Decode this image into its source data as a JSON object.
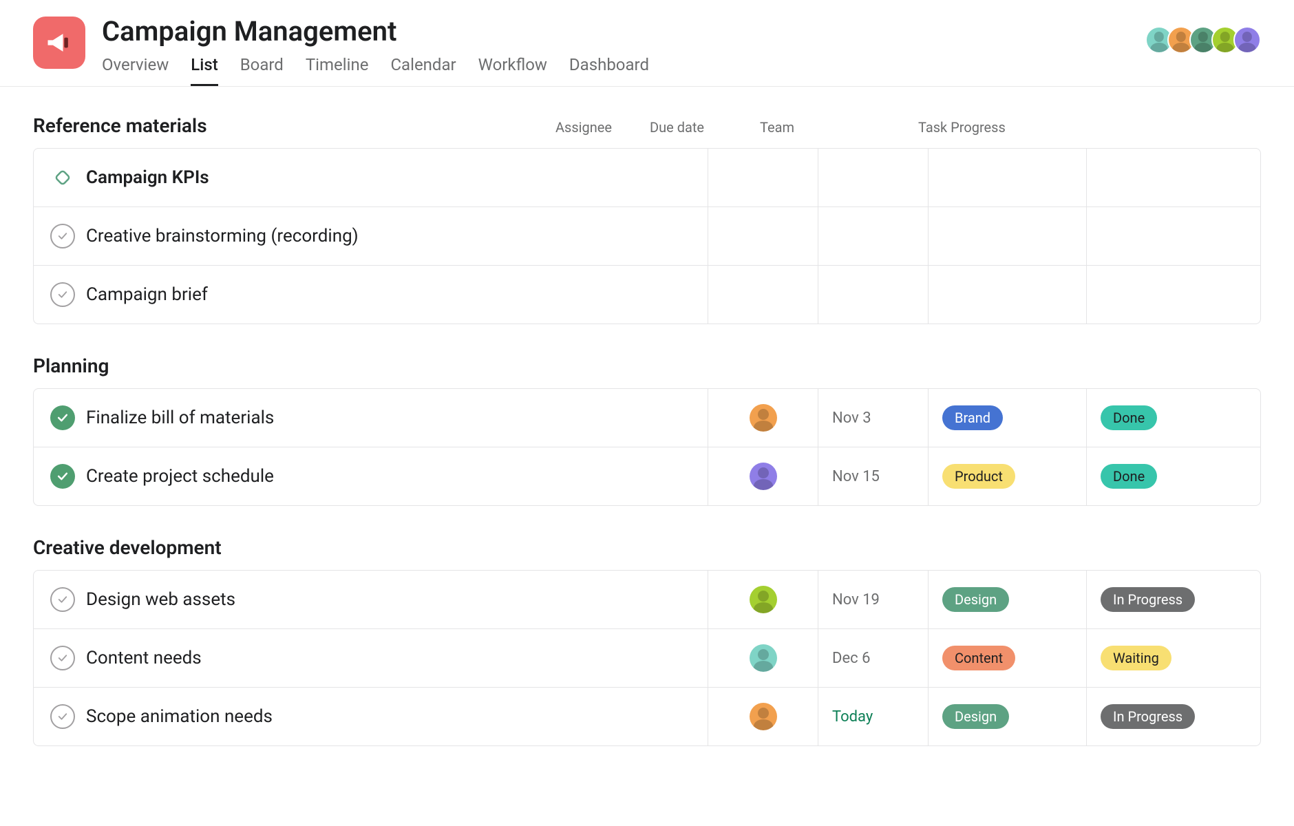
{
  "project": {
    "title": "Campaign Management",
    "icon": "megaphone"
  },
  "tabs": [
    {
      "label": "Overview",
      "active": false
    },
    {
      "label": "List",
      "active": true
    },
    {
      "label": "Board",
      "active": false
    },
    {
      "label": "Timeline",
      "active": false
    },
    {
      "label": "Calendar",
      "active": false
    },
    {
      "label": "Workflow",
      "active": false
    },
    {
      "label": "Dashboard",
      "active": false
    }
  ],
  "members": [
    {
      "color": "#7fd4c6"
    },
    {
      "color": "#f2a04e"
    },
    {
      "color": "#5da283"
    },
    {
      "color": "#a4cf30"
    },
    {
      "color": "#8f7ee7"
    }
  ],
  "columns": {
    "assignee": "Assignee",
    "due": "Due date",
    "team": "Team",
    "progress": "Task Progress"
  },
  "team_colors": {
    "Brand": {
      "bg": "#4573d2",
      "fg": "#ffffff"
    },
    "Product": {
      "bg": "#f8df72",
      "fg": "#1e1f21"
    },
    "Design": {
      "bg": "#5da283",
      "fg": "#ffffff"
    },
    "Content": {
      "bg": "#f1906b",
      "fg": "#1e1f21"
    }
  },
  "progress_colors": {
    "Done": {
      "bg": "#37c5ab",
      "fg": "#1e1f21"
    },
    "In Progress": {
      "bg": "#6d6e6f",
      "fg": "#ffffff"
    },
    "Waiting": {
      "bg": "#f8df72",
      "fg": "#1e1f21"
    }
  },
  "sections": [
    {
      "title": "Reference materials",
      "show_columns": true,
      "tasks": [
        {
          "name": "Campaign KPIs",
          "icon": "milestone",
          "bold": true
        },
        {
          "name": "Creative brainstorming (recording)",
          "icon": "incomplete"
        },
        {
          "name": "Campaign brief",
          "icon": "incomplete"
        }
      ]
    },
    {
      "title": "Planning",
      "tasks": [
        {
          "name": "Finalize bill of materials",
          "icon": "complete",
          "assignee_color": "#f2a04e",
          "due": "Nov 3",
          "team": "Brand",
          "progress": "Done"
        },
        {
          "name": "Create project schedule",
          "icon": "complete",
          "assignee_color": "#8f7ee7",
          "due": "Nov 15",
          "team": "Product",
          "progress": "Done"
        }
      ]
    },
    {
      "title": "Creative development",
      "tasks": [
        {
          "name": "Design web assets",
          "icon": "incomplete",
          "assignee_color": "#a4cf30",
          "due": "Nov 19",
          "team": "Design",
          "progress": "In Progress"
        },
        {
          "name": "Content needs",
          "icon": "incomplete",
          "assignee_color": "#7fd4c6",
          "due": "Dec 6",
          "team": "Content",
          "progress": "Waiting"
        },
        {
          "name": "Scope animation needs",
          "icon": "incomplete",
          "assignee_color": "#f2a04e",
          "due": "Today",
          "due_today": true,
          "team": "Design",
          "progress": "In Progress"
        }
      ]
    }
  ]
}
